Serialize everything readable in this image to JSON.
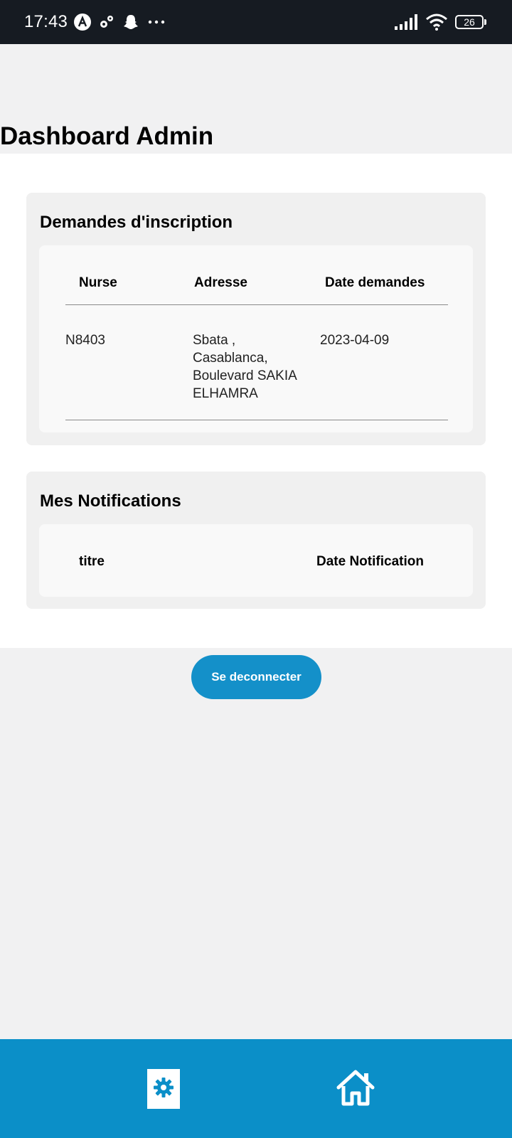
{
  "status_bar": {
    "time": "17:43",
    "battery": "26",
    "icons": [
      "a-circle-icon",
      "gears-icon",
      "snapchat-icon",
      "more-dots-icon",
      "signal-icon",
      "wifi-icon",
      "battery-icon"
    ]
  },
  "page": {
    "title": "Dashboard Admin"
  },
  "requests": {
    "title": "Demandes d'inscription",
    "columns": [
      "Nurse",
      "Adresse",
      "Date demandes"
    ],
    "rows": [
      {
        "nurse": "N8403",
        "address_lines": [
          "Sbata ,",
          "Casablanca,",
          "Boulevard SAKIA",
          "ELHAMRA"
        ],
        "date": "2023-04-09"
      }
    ]
  },
  "notifications": {
    "title": "Mes Notifications",
    "columns": [
      "titre",
      "Date Notification"
    ]
  },
  "logout_label": "Se deconnecter",
  "bottom_nav": {
    "items": [
      "settings-icon",
      "home-icon"
    ]
  },
  "colors": {
    "accent": "#1490c9",
    "nav": "#0b8fc8",
    "status_bar": "#161b22"
  }
}
